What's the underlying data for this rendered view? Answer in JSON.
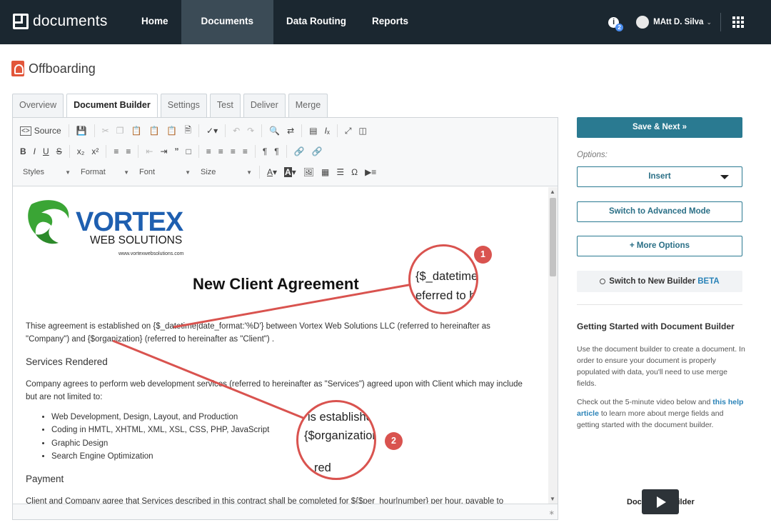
{
  "app": {
    "name": "documents"
  },
  "nav": {
    "items": [
      {
        "label": "Home"
      },
      {
        "label": "Documents",
        "active": true
      },
      {
        "label": "Data Routing"
      },
      {
        "label": "Reports"
      }
    ]
  },
  "user": {
    "name": "MAtt D. Silva",
    "notifications": "2",
    "info_glyph": "i"
  },
  "page": {
    "title": "Offboarding"
  },
  "tabs": [
    {
      "label": "Overview"
    },
    {
      "label": "Document Builder",
      "active": true
    },
    {
      "label": "Settings"
    },
    {
      "label": "Test"
    },
    {
      "label": "Deliver"
    },
    {
      "label": "Merge"
    }
  ],
  "toolbar": {
    "source_label": "Source",
    "styles": "Styles",
    "format": "Format",
    "font": "Font",
    "size": "Size"
  },
  "document": {
    "logo_main": "VORTEX",
    "logo_sub": "WEB SOLUTIONS",
    "logo_url": "www.vortexwebsolutions.com",
    "title": "New Client Agreement",
    "p1": "Thise agreement is established on {$_datetime|date_format:'%D'} between Vortex Web Solutions LLC (referred to hereinafter as \"Company\") and {$organization} (referred to hereinafter as \"Client\") .",
    "h_services": "Services Rendered",
    "p2": "Company agrees to perform web development services (referred to hereinafter as \"Services\") agreed upon with Client which may include but are not limited to:",
    "bullets": [
      "Web Development, Design, Layout, and Production",
      "Coding in HMTL, XHTML, XML, XSL, CSS, PHP, JavaScript",
      "Graphic Design",
      "Search Engine Optimization"
    ],
    "h_payment": "Payment",
    "p3": "Client and Company agree that Services described in this contract shall be completed for ${$per_hour|number} per hour, payable to"
  },
  "callouts": {
    "c1": {
      "num": "1",
      "line1": "{$_datetime",
      "line2": "eferred to he"
    },
    "c2": {
      "num": "2",
      "line1": "is established",
      "line2": "{$organization}",
      "line3": "red"
    }
  },
  "sidebar": {
    "save_label": "Save & Next »",
    "options_label": "Options:",
    "insert_label": "Insert",
    "advanced_label": "Switch to Advanced Mode",
    "more_label": "+ More Options",
    "new_builder_label": "Switch to New Builder",
    "beta_label": "BETA",
    "gs_title": "Getting Started with Document Builder",
    "gs_p1": "Use the document builder to create a document. In order to ensure your document is properly populated with data, you'll need to use merge fields.",
    "gs_p2a": "Check out the 5-minute video below and ",
    "gs_link": "this help article",
    "gs_p2b": " to learn more about merge fields and getting started with the document builder.",
    "video_label": "Document Builder"
  },
  "colors": {
    "topbar": "#1b2730",
    "accent": "#2a7a91",
    "callout": "#d9534f",
    "logo_blue": "#1e5fb0",
    "logo_green": "#3aa535"
  }
}
